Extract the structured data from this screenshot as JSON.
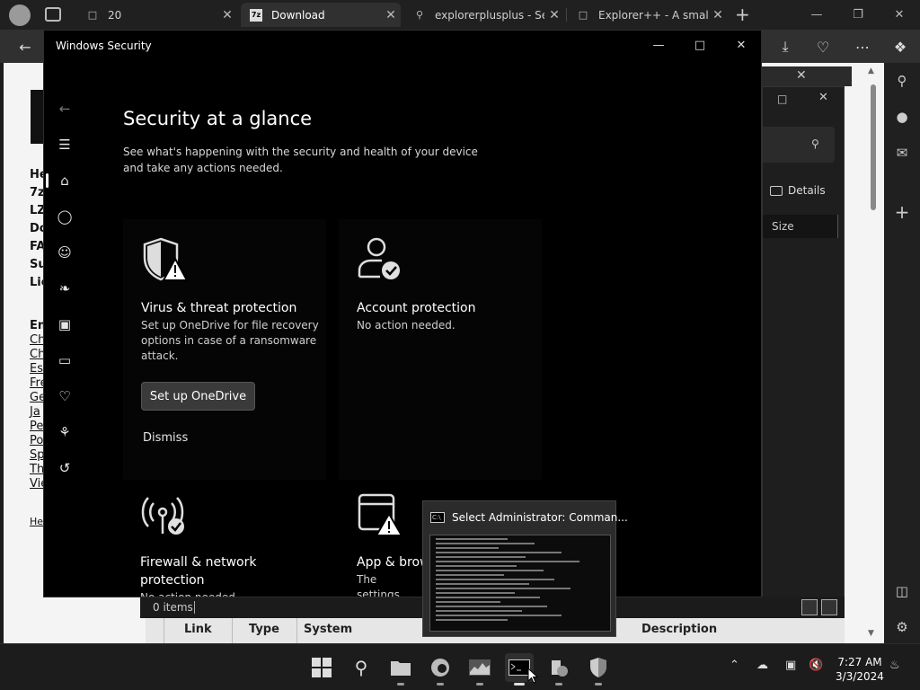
{
  "browser": {
    "tabs": [
      {
        "icon": "page-icon",
        "title": "20"
      },
      {
        "icon": "7zip-icon",
        "title": "Download"
      },
      {
        "icon": "search-icon",
        "title": "explorerplusplus - Sea"
      },
      {
        "icon": "page-icon",
        "title": "Explorer++ - A small a"
      }
    ]
  },
  "page": {
    "lines": [
      "He",
      "7z",
      "LZ",
      "Do",
      "FA",
      "Su",
      "Lic"
    ],
    "links_header": "En",
    "links": [
      "Ch",
      "Ch",
      "Es",
      "Fre",
      "Ge",
      "Ja",
      "Pe",
      "Po",
      "Sp",
      "Th",
      "Vie"
    ],
    "footer_link": "He"
  },
  "explorer": {
    "details_label": "Details",
    "size_header": "Size",
    "status": "0 items",
    "columns": [
      "Link",
      "Type",
      "System",
      "Description"
    ]
  },
  "windows_security": {
    "title": "Windows Security",
    "heading": "Security at a glance",
    "subheading": "See what's happening with the security and health of your device and take any actions needed.",
    "cards": {
      "virus": {
        "title": "Virus & threat protection",
        "desc": "Set up OneDrive for file recovery options in case of a ransomware attack.",
        "button": "Set up OneDrive",
        "dismiss": "Dismiss"
      },
      "account": {
        "title": "Account protection",
        "desc": "No action needed."
      },
      "firewall": {
        "title": "Firewall & network protection",
        "desc": "No action needed"
      },
      "app": {
        "title": "App & brow",
        "desc": "The settings unwanted ap"
      }
    }
  },
  "thumbnail": {
    "title": "Select Administrator: Comman..."
  },
  "clock": {
    "time": "7:27 AM",
    "date": "3/3/2024"
  },
  "colors": {
    "accent": "#ffffff",
    "warning": "#ffffff",
    "ok": "#e0e0e0"
  }
}
